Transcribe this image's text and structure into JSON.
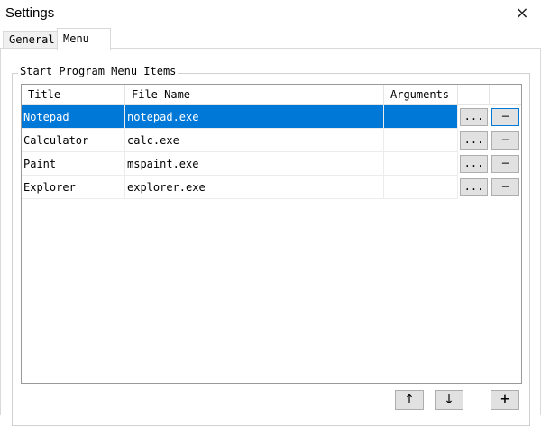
{
  "window": {
    "title": "Settings",
    "close_icon": "×"
  },
  "tabs": [
    {
      "label": "General",
      "active": false
    },
    {
      "label": "Menu",
      "active": true
    }
  ],
  "group": {
    "label": "Start Program Menu Items"
  },
  "grid": {
    "columns": [
      "Title",
      "File Name",
      "Arguments"
    ],
    "rows": [
      {
        "title": "Notepad",
        "file": "notepad.exe",
        "args": "",
        "selected": true
      },
      {
        "title": "Calculator",
        "file": "calc.exe",
        "args": "",
        "selected": false
      },
      {
        "title": "Paint",
        "file": "mspaint.exe",
        "args": "",
        "selected": false
      },
      {
        "title": "Explorer",
        "file": "explorer.exe",
        "args": "",
        "selected": false
      }
    ],
    "browse_label": "...",
    "remove_label": "−"
  },
  "buttons": {
    "up_label": "↑",
    "down_label": "↓",
    "add_label": "+"
  },
  "colors": {
    "selection": "#0078d7"
  }
}
